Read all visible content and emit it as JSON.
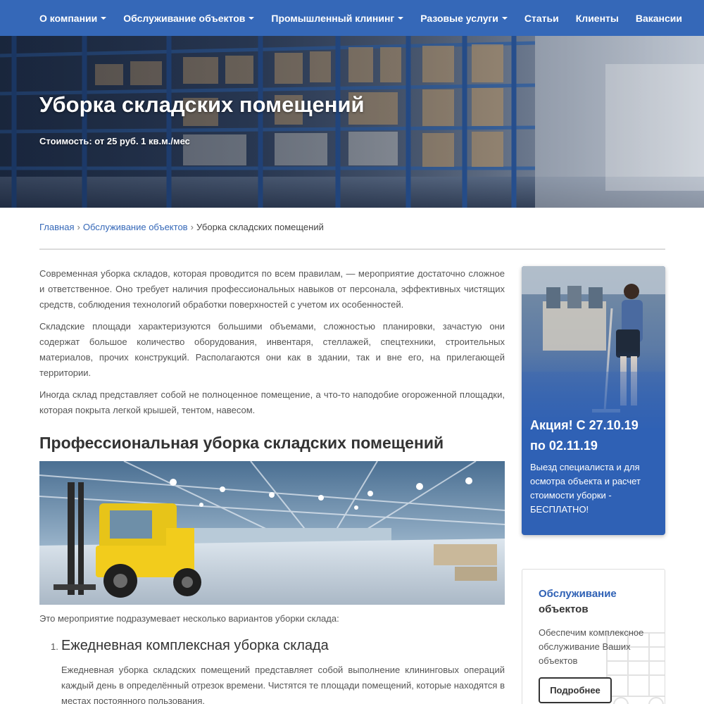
{
  "nav": {
    "items": [
      {
        "label": "О компании",
        "has_dropdown": true
      },
      {
        "label": "Обслуживание объектов",
        "has_dropdown": true
      },
      {
        "label": "Промышленный клининг",
        "has_dropdown": true
      },
      {
        "label": "Разовые услуги",
        "has_dropdown": true
      },
      {
        "label": "Статьи",
        "has_dropdown": false
      },
      {
        "label": "Клиенты",
        "has_dropdown": false
      },
      {
        "label": "Вакансии",
        "has_dropdown": false
      }
    ]
  },
  "hero": {
    "title": "Уборка складских помещений",
    "price": "Стоимость: от 25 руб. 1 кв.м./мес"
  },
  "breadcrumb": {
    "home": "Главная",
    "section": "Обслуживание объектов",
    "current": "Уборка складских помещений",
    "separator": "›"
  },
  "article": {
    "paragraphs": [
      "Современная уборка складов, которая проводится по всем правилам, — мероприятие достаточно сложное и ответственное. Оно требует наличия профессиональных навыков от персонала, эффективных чистящих средств, соблюдения технологий обработки поверхностей с учетом их особенностей.",
      "Складские площади характеризуются большими объемами, сложностью планировки, зачастую они содержат большое количество оборудования, инвентаря, стеллажей, спецтехники, строительных материалов, прочих конструкций. Располагаются они как в здании, так и вне его, на прилегающей территории.",
      "Иногда склад представляет собой не полноценное помещение, а что-то наподобие огороженной площадки, которая покрыта легкой крышей, тентом, навесом."
    ],
    "heading": "Профессиональная уборка складских помещений",
    "caption": "Это мероприятие подразумевает несколько вариантов уборки склада:",
    "steps": [
      {
        "number": "1.",
        "title": "Ежедневная комплексная уборка склада",
        "text": "Ежедневная уборка складских помещений представляет собой выполнение клининговых операций каждый день в определённый отрезок времени. Чистятся те площади помещений, которые находятся в местах постоянного пользования."
      }
    ]
  },
  "sidebar": {
    "promo": {
      "title_line1": "Акция! С 27.10.19",
      "title_line2": "по 02.11.19",
      "text": "Выезд специалиста и для осмотра объекта и расчет стоимости уборки - БЕСПЛАТНО!"
    },
    "service_card": {
      "title_line1": "Обслуживание",
      "title_line2": "объектов",
      "text": "Обеспечим комплексное обслуживание Ваших объектов",
      "button": "Подробнее"
    }
  },
  "colors": {
    "brand_blue": "#3568b8",
    "promo_blue": "#2f61b5",
    "text": "#333333",
    "muted_text": "#555555"
  },
  "icons": [
    "caret-down-icon",
    "truck-icon"
  ]
}
